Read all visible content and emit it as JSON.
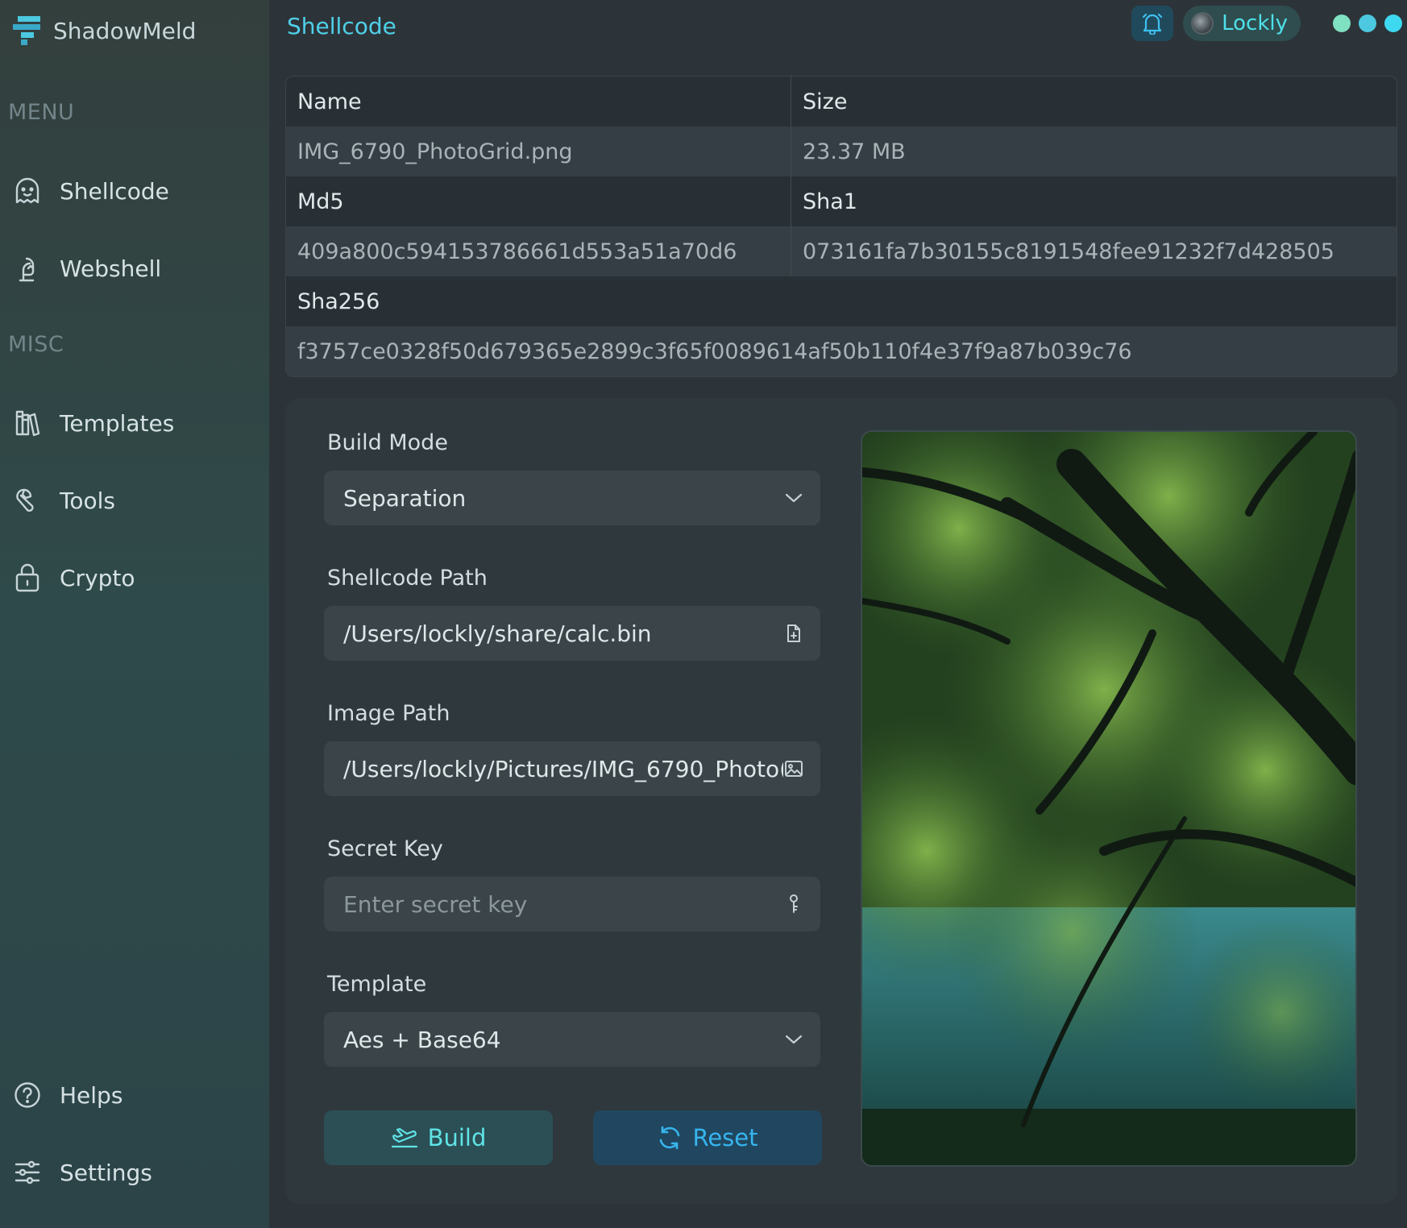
{
  "app": {
    "name": "ShadowMeld"
  },
  "sidebar": {
    "menu_label": "MENU",
    "misc_label": "MISC",
    "items": [
      {
        "label": "Shellcode",
        "icon": "ghost-icon"
      },
      {
        "label": "Webshell",
        "icon": "webshell-icon"
      },
      {
        "label": "Templates",
        "icon": "books-icon"
      },
      {
        "label": "Tools",
        "icon": "wrench-icon"
      },
      {
        "label": "Crypto",
        "icon": "lock-icon"
      },
      {
        "label": "Helps",
        "icon": "help-circle-icon"
      },
      {
        "label": "Settings",
        "icon": "sliders-icon"
      }
    ]
  },
  "header": {
    "title": "Shellcode",
    "user_name": "Lockly",
    "status_colors": [
      "#7fe0c2",
      "#4cc9e0",
      "#3ed8f0"
    ],
    "accent": "#4fd0e8"
  },
  "file_info": {
    "name_label": "Name",
    "size_label": "Size",
    "name_value": "IMG_6790_PhotoGrid.png",
    "size_value": "23.37 MB",
    "md5_label": "Md5",
    "sha1_label": "Sha1",
    "md5_value": "409a800c594153786661d553a51a70d6",
    "sha1_value": "073161fa7b30155c8191548fee91232f7d428505",
    "sha256_label": "Sha256",
    "sha256_value": "f3757ce0328f50d679365e2899c3f65f0089614af50b110f4e37f9a87b039c76"
  },
  "form": {
    "build_mode_label": "Build Mode",
    "build_mode_value": "Separation",
    "shellcode_path_label": "Shellcode Path",
    "shellcode_path_value": "/Users/lockly/share/calc.bin",
    "image_path_label": "Image Path",
    "image_path_value": "/Users/lockly/Pictures/IMG_6790_Photo(",
    "secret_key_label": "Secret Key",
    "secret_key_placeholder": "Enter secret key",
    "template_label": "Template",
    "template_value": "Aes + Base64",
    "build_label": "Build",
    "reset_label": "Reset"
  }
}
